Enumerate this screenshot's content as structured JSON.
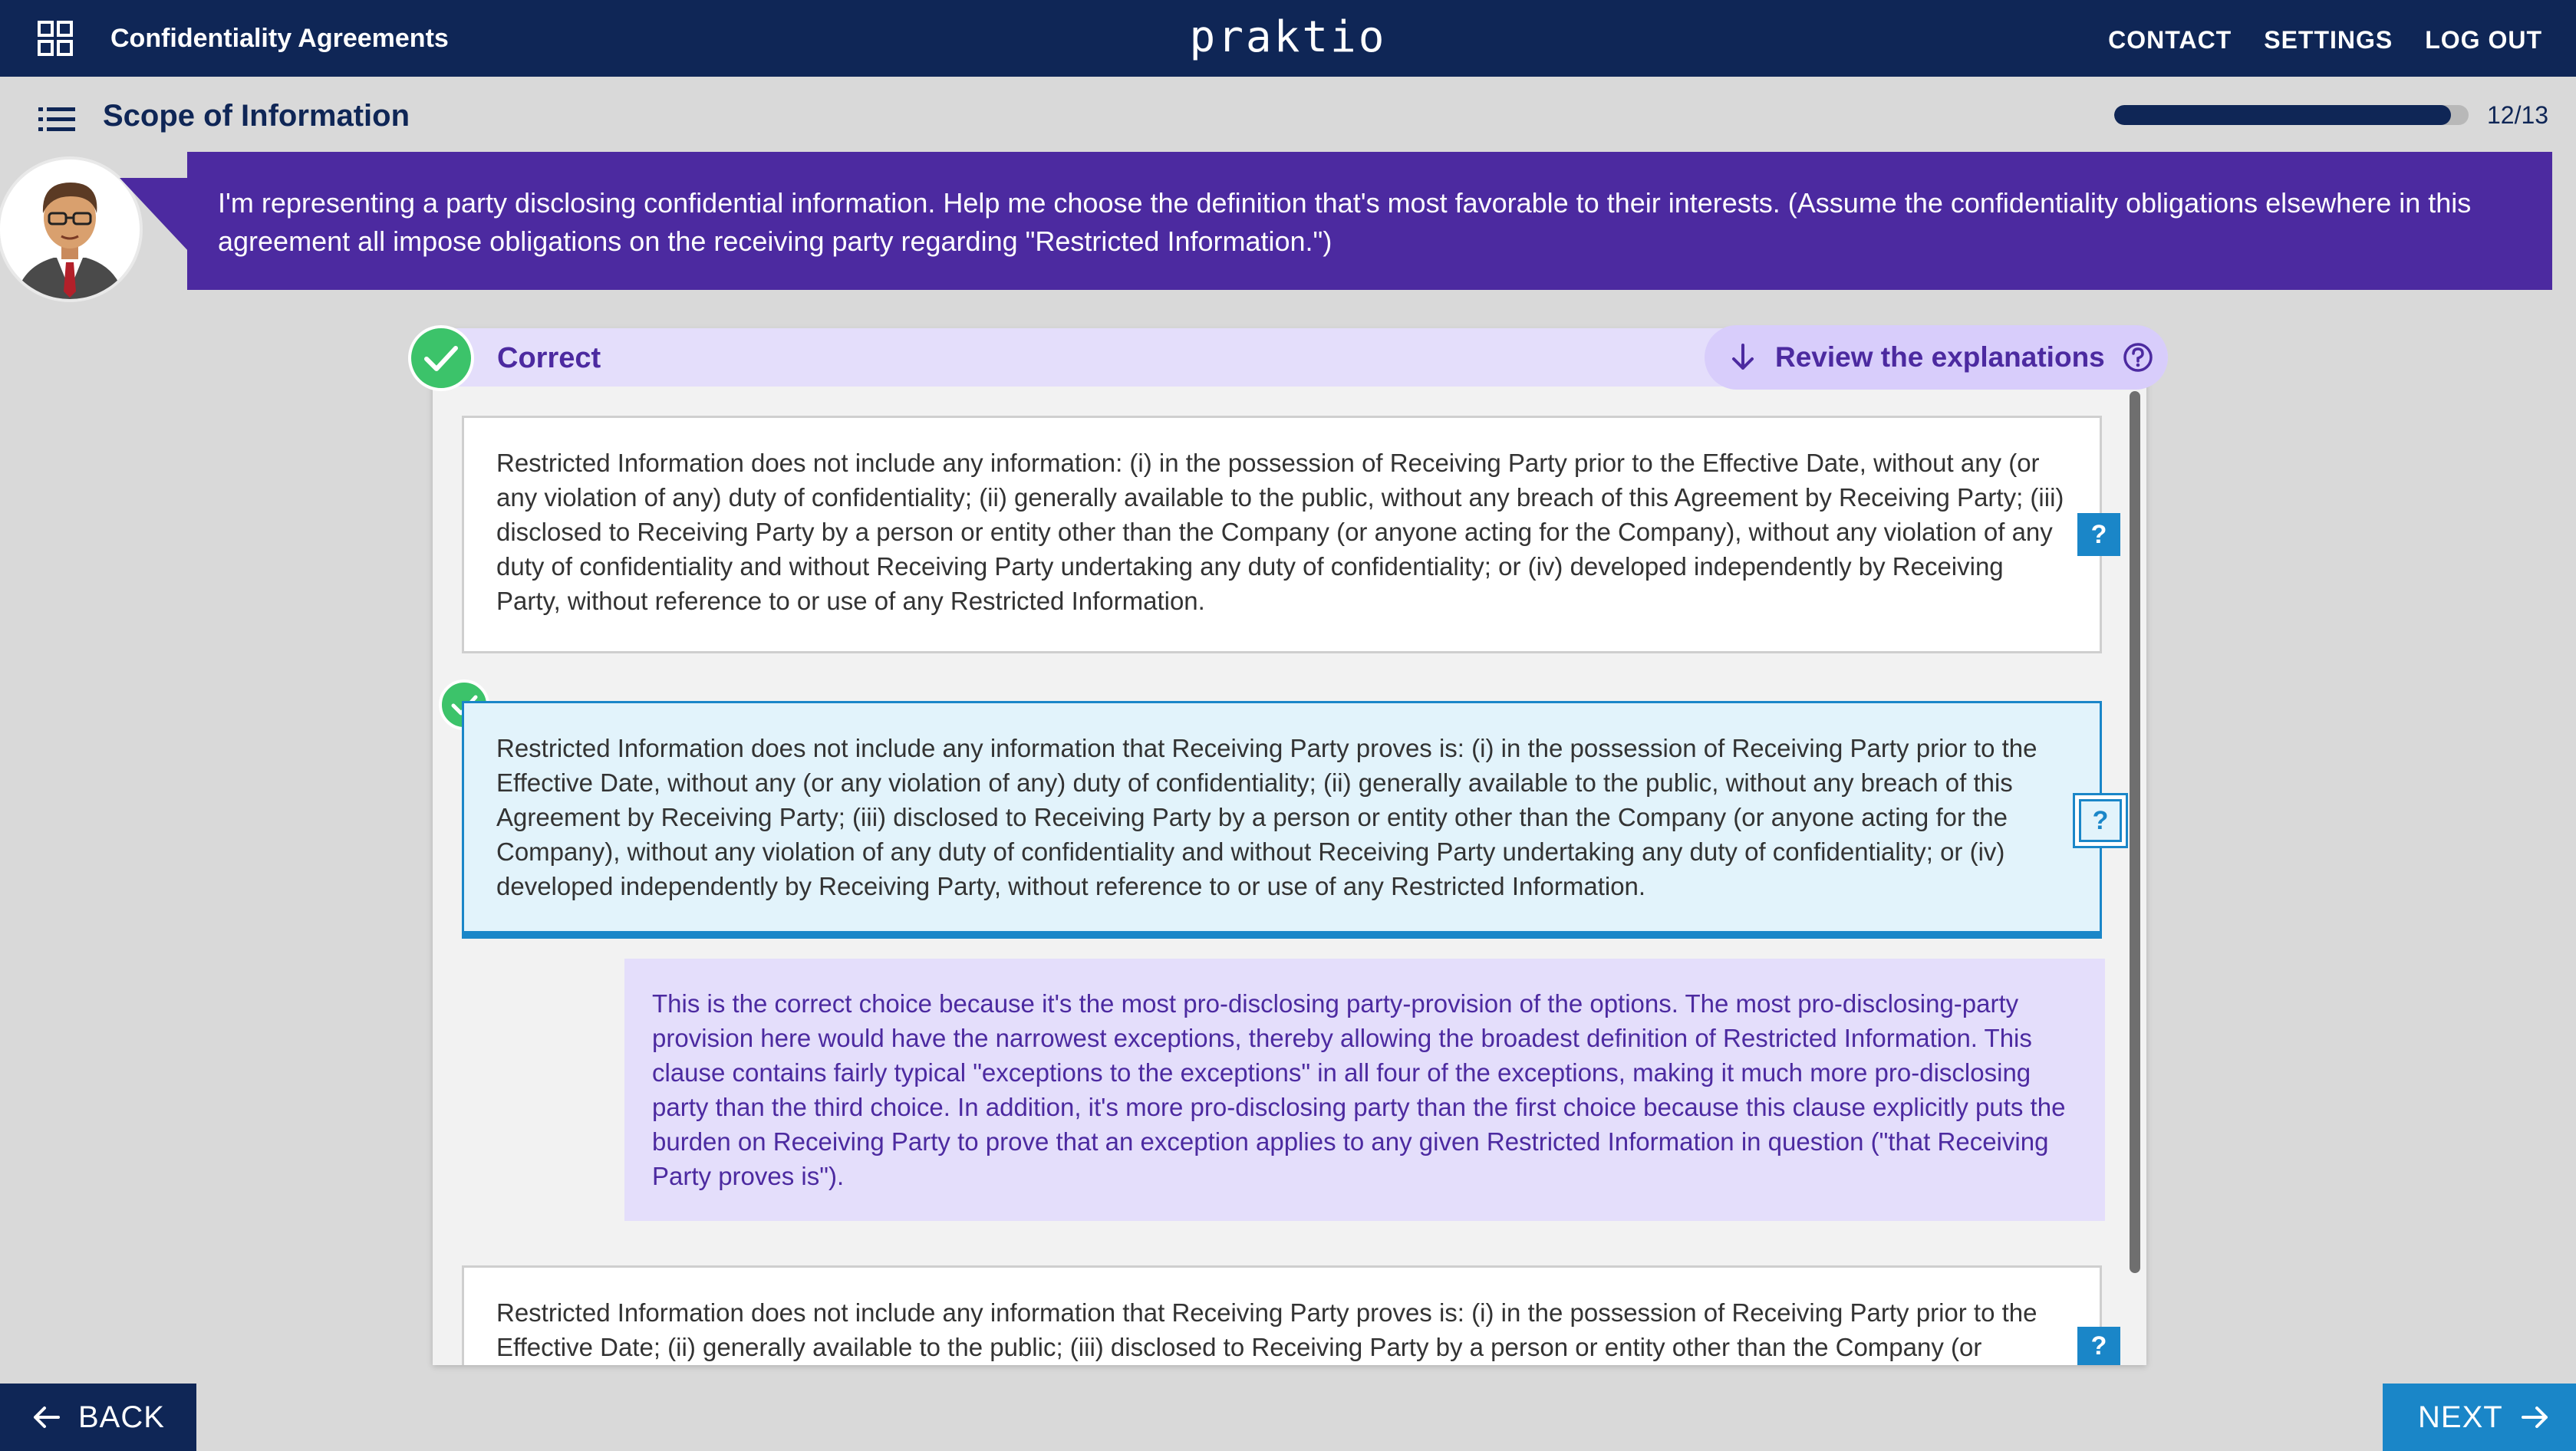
{
  "header": {
    "course_title": "Confidentiality Agreements",
    "brand": "praktio",
    "nav": {
      "contact": "CONTACT",
      "settings": "SETTINGS",
      "logout": "LOG OUT"
    }
  },
  "section": {
    "title": "Scope of Information",
    "progress": {
      "current": 12,
      "total": 13,
      "label": "12/13",
      "fraction": 0.95
    }
  },
  "prompt": {
    "text": "I'm representing a party disclosing confidential information. Help me choose the definition that's most favorable to their interests. (Assume the confidentiality obligations elsewhere in this agreement all impose obligations on the receiving party regarding \"Restricted Information.\")"
  },
  "result": {
    "status": "Correct",
    "review_label": "Review the explanations"
  },
  "options": [
    {
      "text": "Restricted Information does not include any information: (i) in the possession of Receiving Party prior to the Effective Date, without any (or any violation of any) duty of confidentiality; (ii) generally available to the public, without any breach of this Agreement by Receiving Party; (iii) disclosed to Receiving Party by a person or entity other than the Company (or anyone acting for the Company), without any violation of any duty of confidentiality and without Receiving Party undertaking any duty of confidentiality; or (iv) developed independently by Receiving Party, without reference to or use of any Restricted Information.",
      "help": "?"
    },
    {
      "text": "Restricted Information does not include any information that Receiving Party proves is: (i) in the possession of Receiving Party prior to the Effective Date, without any (or any violation of any) duty of confidentiality; (ii) generally available to the public, without any breach of this Agreement by Receiving Party; (iii) disclosed to Receiving Party by a person or entity other than the Company (or anyone acting for the Company), without any violation of any duty of confidentiality and without Receiving Party undertaking any duty of confidentiality; or (iv) developed independently by Receiving Party, without reference to or use of any Restricted Information.",
      "help": "?",
      "selected": true
    },
    {
      "text": "Restricted Information does not include any information that Receiving Party proves is: (i) in the possession of Receiving Party prior to the Effective Date; (ii) generally available to the public; (iii) disclosed to Receiving Party by a person or entity other than the Company (or",
      "help": "?"
    }
  ],
  "explanation": {
    "text": "This is the correct choice because it's the most pro-disclosing party-provision of the options. The most pro-disclosing-party provision here would have the narrowest exceptions, thereby allowing the broadest definition of Restricted Information. This clause contains fairly typical \"exceptions to the exceptions\" in all four of the exceptions, making it much more pro-disclosing party than the third choice. In addition, it's more pro-disclosing party than the first choice because this clause explicitly puts the burden on Receiving Party to prove that an exception applies to any given Restricted Information in question (\"that Receiving Party proves is\")."
  },
  "footer": {
    "back": "BACK",
    "next": "NEXT"
  },
  "colors": {
    "navy": "#0f2656",
    "purple": "#4c2aa0",
    "lavender": "#e4defb",
    "blue": "#1a86c8",
    "green": "#3cc36a",
    "selected_bg": "#e2f3fb"
  }
}
